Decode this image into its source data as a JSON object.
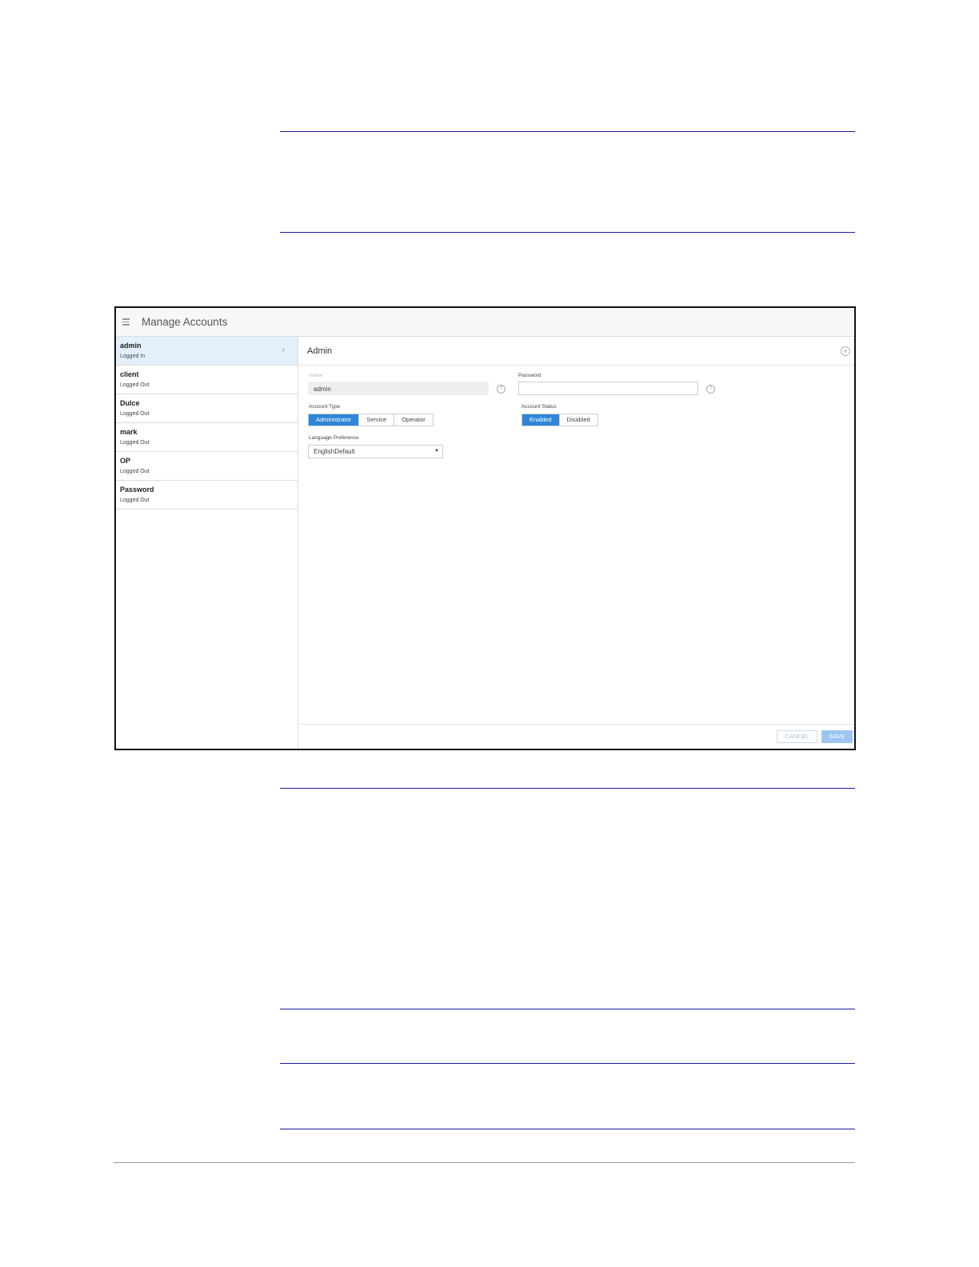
{
  "window": {
    "title": "Manage Accounts"
  },
  "accounts": [
    {
      "name": "admin",
      "status": "Logged In"
    },
    {
      "name": "client",
      "status": "Logged Out"
    },
    {
      "name": "Dulce",
      "status": "Logged Out"
    },
    {
      "name": "mark",
      "status": "Logged Out"
    },
    {
      "name": "OP",
      "status": "Logged Out"
    },
    {
      "name": "Password",
      "status": "Logged Out"
    }
  ],
  "detail": {
    "title": "Admin",
    "name_label": "Name",
    "name_value": "admin",
    "password_label": "Password",
    "password_value": "",
    "account_type_label": "Account Type",
    "account_types": [
      "Administrator",
      "Service",
      "Operator"
    ],
    "account_type_selected": "Administrator",
    "account_status_label": "Account Status",
    "account_statuses": [
      "Enabled",
      "Disabled"
    ],
    "account_status_selected": "Enabled",
    "language_label": "Language Preference",
    "language_value": "EnglishDefault"
  },
  "actions": {
    "cancel_label": "CANCEL",
    "save_label": "SAVE"
  },
  "colors": {
    "accent": "#2f86d8",
    "selected_row": "#e3f0fb",
    "document_rule": "#1a1aa6"
  },
  "icons": {
    "menu": "hamburger-menu-icon",
    "chevron": "chevron-right-icon",
    "add": "add-circle-icon",
    "help": "help-circle-icon",
    "dropdown": "caret-down-icon"
  }
}
